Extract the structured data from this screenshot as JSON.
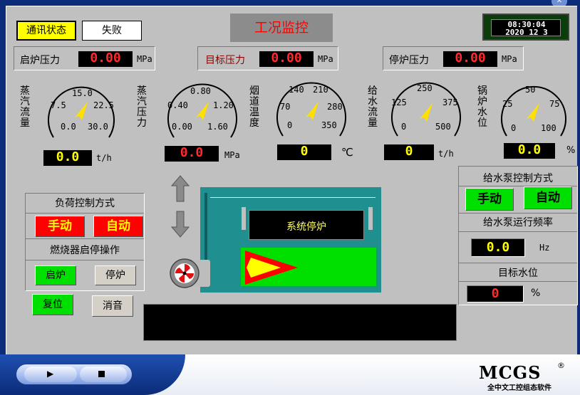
{
  "header": {
    "comm_status_label": "通讯状态",
    "comm_status_value": "失败",
    "title": "工况监控",
    "clock_time": "08:30:04",
    "clock_date": "2020 12  3"
  },
  "pressures": [
    {
      "label": "启炉压力",
      "value": "0.00",
      "unit": "MPa"
    },
    {
      "label": "目标压力",
      "value": "0.00",
      "unit": "MPa"
    },
    {
      "label": "停炉压力",
      "value": "0.00",
      "unit": "MPa"
    }
  ],
  "gauges": [
    {
      "title": "蒸汽流量",
      "ticks": [
        "7.5",
        "15.0",
        "22.5",
        "0.0",
        "30.0"
      ],
      "reading": "0.0",
      "unit": "t/h"
    },
    {
      "title": "蒸汽压力",
      "ticks": [
        "0.40",
        "0.80",
        "1.20",
        "0.00",
        "1.60"
      ],
      "reading": "0.0",
      "unit": "MPa"
    },
    {
      "title": "烟道温度",
      "ticks": [
        "70",
        "140",
        "210",
        "280",
        "0",
        "350"
      ],
      "reading": "0",
      "unit": "℃"
    },
    {
      "title": "给水流量",
      "ticks": [
        "125",
        "250",
        "375",
        "0",
        "500"
      ],
      "reading": "0",
      "unit": "t/h"
    },
    {
      "title": "锅炉水位",
      "ticks": [
        "25",
        "50",
        "75",
        "0",
        "100"
      ],
      "reading": "0.0",
      "unit": "%"
    }
  ],
  "load_control": {
    "title": "负荷控制方式",
    "manual_label": "手动",
    "auto_label": "自动",
    "burner_title": "燃烧器启停操作",
    "start_label": "启炉",
    "stop_label": "停炉",
    "reset_label": "复位",
    "mute_label": "消音"
  },
  "boiler": {
    "status_text": "系统停炉"
  },
  "pump_control": {
    "title": "给水泵控制方式",
    "manual_label": "手动",
    "auto_label": "自动",
    "freq_title": "给水泵运行频率",
    "freq_value": "0.0",
    "freq_unit": "Hz",
    "target_level_title": "目标水位",
    "target_level_value": "0",
    "target_level_unit": "%"
  },
  "footer": {
    "play_icon": "play-icon",
    "stop_icon": "stop-icon",
    "brand": "MCGS",
    "registered": "®",
    "brand_subtitle": "全中文工控组态软件"
  },
  "colors": {
    "panel": "#c0c0c0",
    "frame": "#0c2b78",
    "digit_red": "#ff2a2a",
    "digit_yellow": "#ffff00",
    "boiler_teal": "#1f8f8f",
    "active_green": "#00e000",
    "alarm_red": "#ff0000"
  }
}
